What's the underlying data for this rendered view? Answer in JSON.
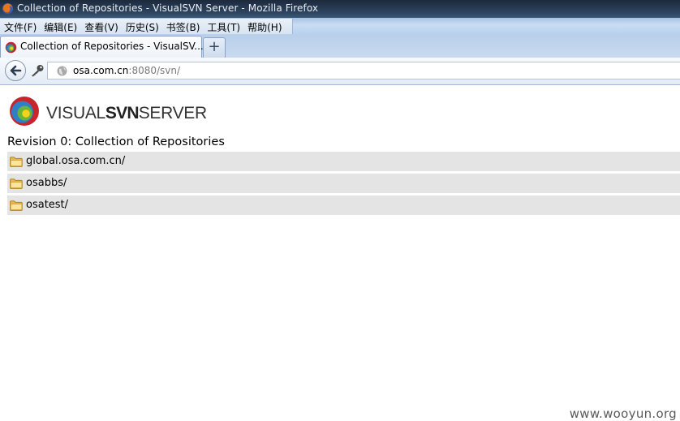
{
  "window": {
    "title": "Collection of Repositories - VisualSVN Server - Mozilla Firefox"
  },
  "menubar": {
    "items": [
      "文件(F)",
      "编辑(E)",
      "查看(V)",
      "历史(S)",
      "书签(B)",
      "工具(T)",
      "帮助(H)"
    ]
  },
  "tabs": [
    {
      "label": "Collection of Repositories - VisualSV...",
      "favicon": "visualsvn-logo-icon"
    }
  ],
  "newtab": {
    "label": "+"
  },
  "urlbar": {
    "host": "osa.com.cn",
    "path": ":8080/svn/"
  },
  "logo": {
    "text_light": "VISUAL",
    "text_bold": "SVN",
    "text_tail": "SERVER"
  },
  "page": {
    "heading": "Revision 0: Collection of Repositories",
    "repos": [
      "global.osa.com.cn/",
      "osabbs/",
      "osatest/"
    ]
  },
  "watermark": "www.wooyun.org",
  "colors": {
    "row_bg": "#e4e4e4",
    "title_bg": "#2e4460",
    "menubar_bg": "#c9ddf3"
  }
}
